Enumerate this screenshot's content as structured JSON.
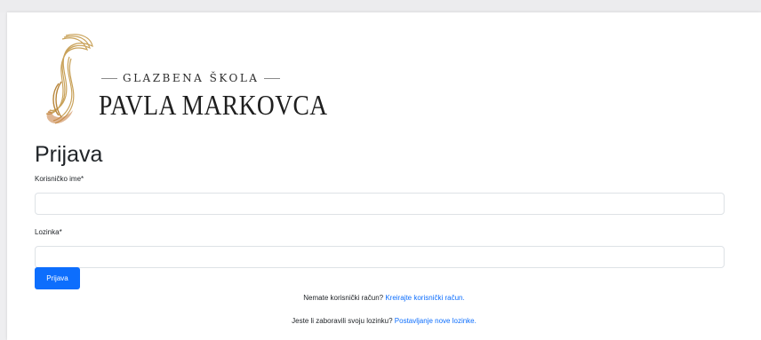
{
  "logo": {
    "top_text": "GLAZBENA ŠKOLA",
    "main_text": "PAVLA MARKOVCA",
    "gold_color": "#c9a25a"
  },
  "form": {
    "title": "Prijava",
    "username_label": "Korisničko ime*",
    "username_value": "",
    "password_label": "Lozinka*",
    "password_value": "",
    "submit_label": "Prijava"
  },
  "footer": {
    "no_account_text": "Nemate korisnički račun?",
    "create_account_link": "Kreirajte korisnički račun.",
    "forgot_password_text": "Jeste li zaboravili svoju lozinku?",
    "reset_password_link": "Postavljanje nove lozinke."
  },
  "colors": {
    "primary": "#0d6efd",
    "border": "#dee2e6"
  }
}
